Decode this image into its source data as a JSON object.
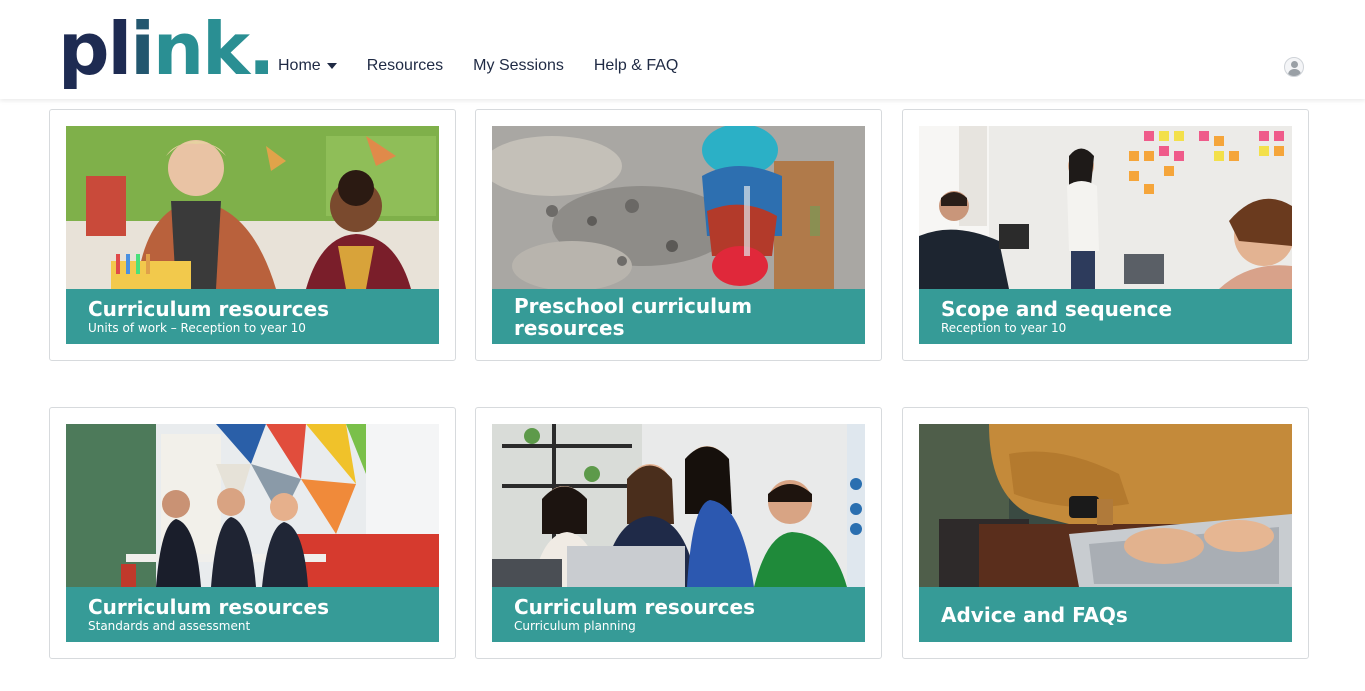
{
  "header": {
    "logo": {
      "p1": "pl",
      "p2": "i",
      "p3": "nk",
      "dot": "."
    },
    "nav": [
      {
        "label": "Home",
        "has_dropdown": true
      },
      {
        "label": "Resources"
      },
      {
        "label": "My Sessions"
      },
      {
        "label": "Help & FAQ"
      }
    ],
    "avatar_icon": "user-avatar-icon"
  },
  "cards": [
    {
      "title": "Curriculum resources",
      "subtitle": "Units of work – Reception to year 10",
      "image": "teacher-and-student-photo"
    },
    {
      "title": "Preschool curriculum resources",
      "subtitle": "",
      "image": "child-playing-in-sand-photo"
    },
    {
      "title": "Scope and sequence",
      "subtitle": "Reception to year 10",
      "image": "office-sticky-notes-photo"
    },
    {
      "title": "Curriculum resources",
      "subtitle": "Standards and assessment",
      "image": "students-studying-photo"
    },
    {
      "title": "Curriculum resources",
      "subtitle": "Curriculum planning",
      "image": "team-around-laptop-photo"
    },
    {
      "title": "Advice and FAQs",
      "subtitle": "",
      "image": "hands-on-laptop-photo"
    }
  ],
  "colors": {
    "banner": "#369b97",
    "logo_dark": "#1e2b52",
    "logo_teal": "#2a8f93"
  }
}
